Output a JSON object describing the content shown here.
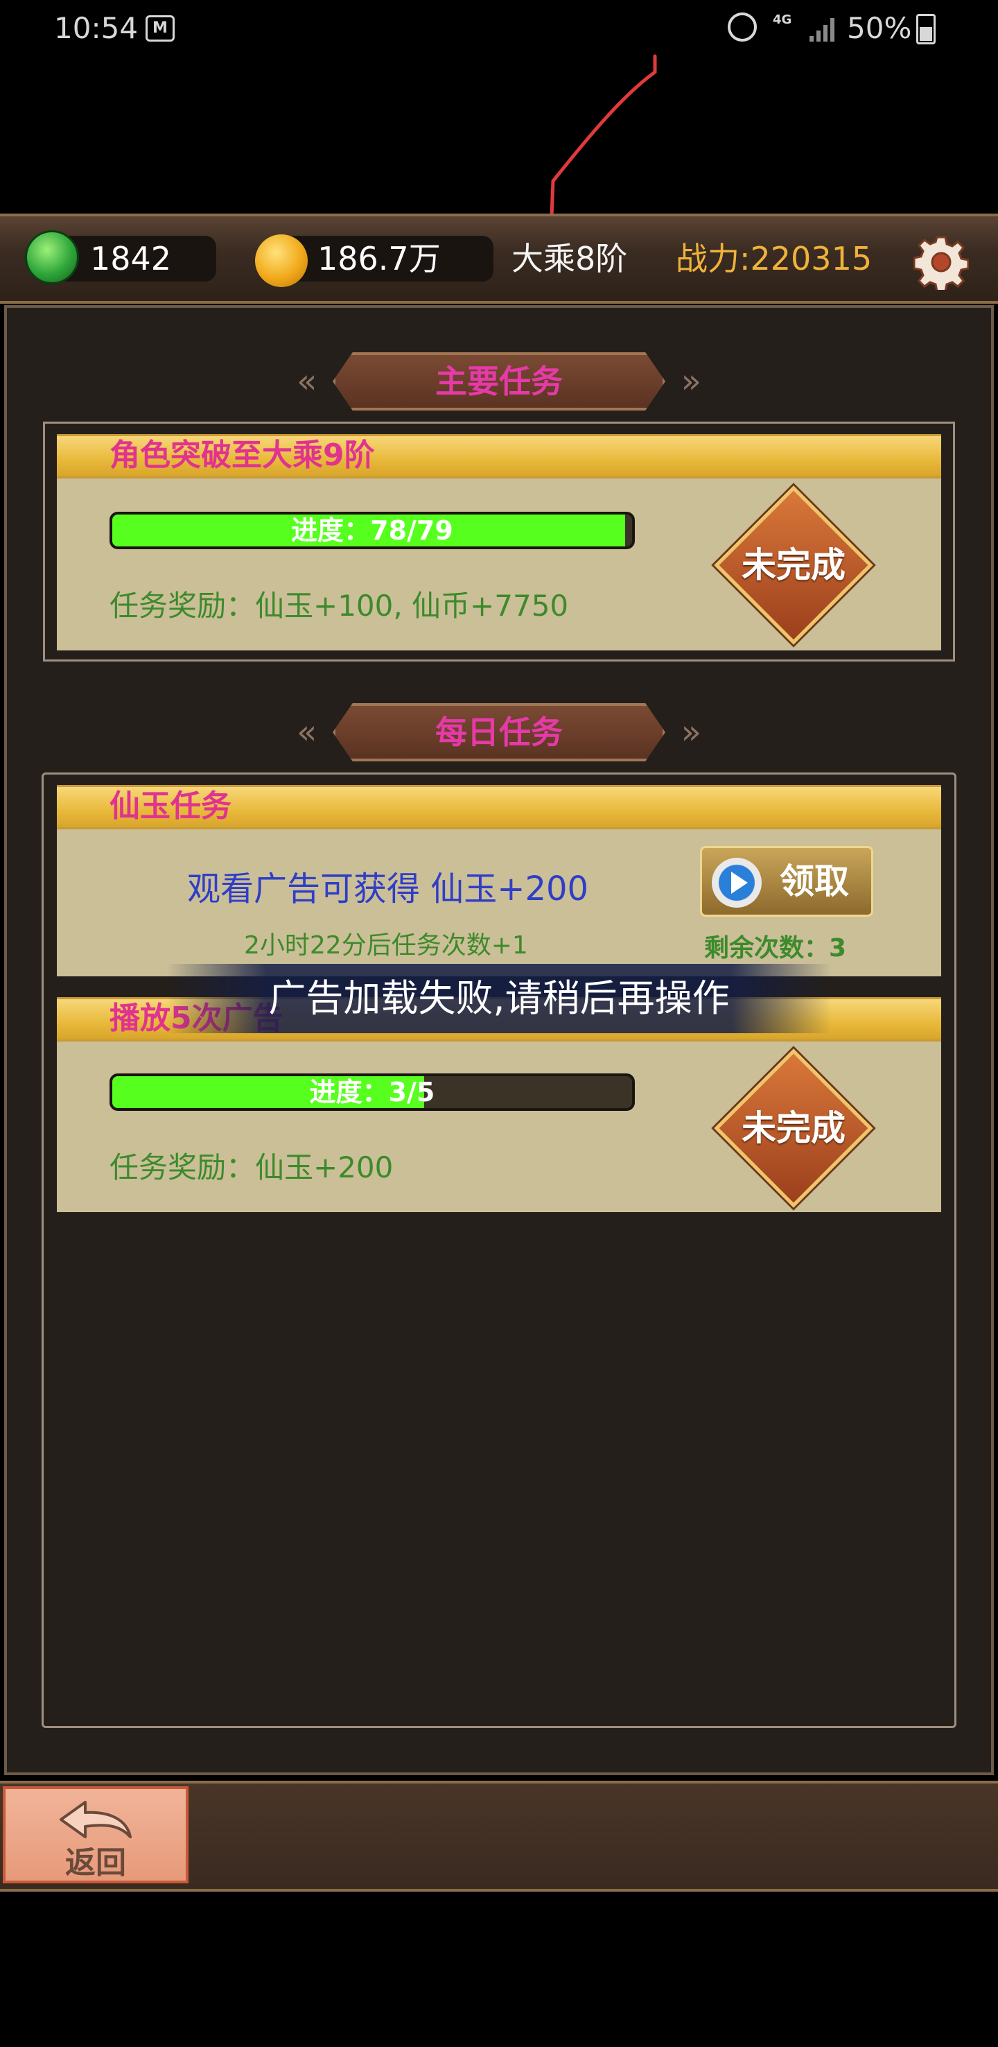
{
  "status_bar": {
    "time": "10:54",
    "mail_badge": "M",
    "network": "4G",
    "battery_percent": "50%"
  },
  "resources": {
    "jade": "1842",
    "coins": "186.7万",
    "realm": "大乘8阶",
    "power": "战力:220315"
  },
  "main_quest": {
    "section_title": "主要任务",
    "title": "角色突破至大乘9阶",
    "progress_text": "进度：78/79",
    "progress_fraction": 0.987,
    "reward": "任务奖励：仙玉+100, 仙币+7750",
    "status": "未完成"
  },
  "daily": {
    "section_title": "每日任务",
    "jade_task": {
      "title": "仙玉任务",
      "description": "观看广告可获得 仙玉+200",
      "timer": "2小时22分后任务次数+1",
      "remaining": "剩余次数：3",
      "claim_label": "领取"
    },
    "ad_task": {
      "title": "播放5次广告",
      "progress_text": "进度：3/5",
      "progress_fraction": 0.6,
      "reward": "任务奖励：仙玉+200",
      "status": "未完成"
    }
  },
  "toast": "广告加载失败,请稍后再操作",
  "back_label": "返回",
  "colors": {
    "progress_green": "#57ff1e",
    "title_pink": "#e0338f",
    "power_orange": "#f0b23a",
    "reward_green": "#3d8a2c"
  }
}
